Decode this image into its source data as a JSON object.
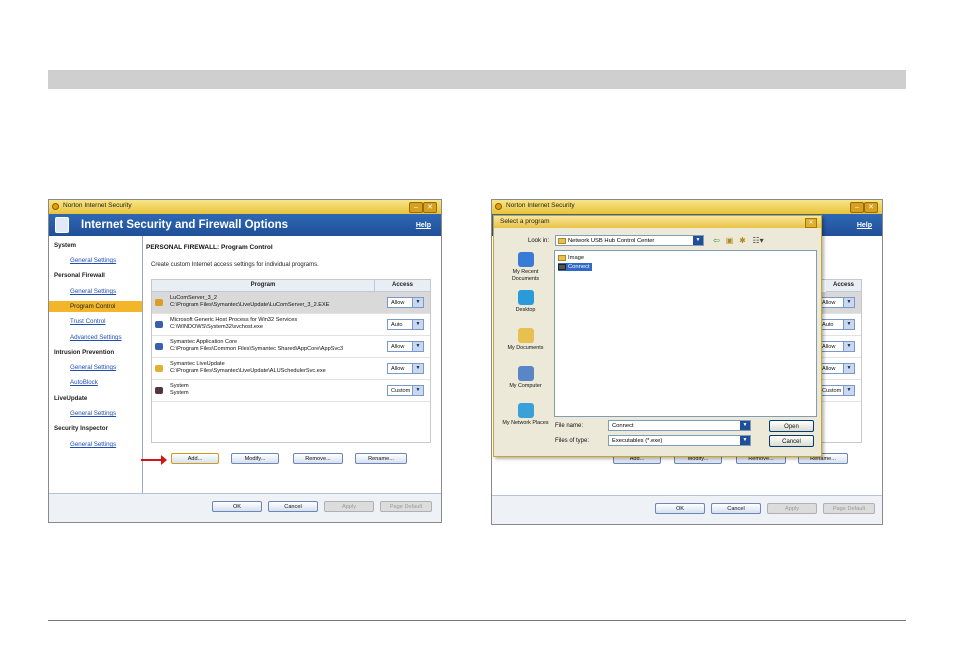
{
  "left_window": {
    "title": "Norton Internet Security",
    "header_title": "Internet Security and Firewall Options",
    "help": "Help",
    "sidebar": [
      {
        "label": "System",
        "kind": "cat"
      },
      {
        "label": "General Settings",
        "kind": "sub"
      },
      {
        "label": "Personal Firewall",
        "kind": "cat"
      },
      {
        "label": "General Settings",
        "kind": "sub"
      },
      {
        "label": "Program Control",
        "kind": "sub",
        "selected": true
      },
      {
        "label": "Trust Control",
        "kind": "sub"
      },
      {
        "label": "Advanced Settings",
        "kind": "sub"
      },
      {
        "label": "Intrusion Prevention",
        "kind": "cat"
      },
      {
        "label": "General Settings",
        "kind": "sub"
      },
      {
        "label": "AutoBlock",
        "kind": "sub"
      },
      {
        "label": "LiveUpdate",
        "kind": "cat"
      },
      {
        "label": "General Settings",
        "kind": "sub"
      },
      {
        "label": "Security Inspector",
        "kind": "cat"
      },
      {
        "label": "General Settings",
        "kind": "sub"
      }
    ],
    "content_heading": "PERSONAL FIREWALL: Program Control",
    "content_desc": "Create custom Internet access settings for individual programs.",
    "columns": {
      "program": "Program",
      "access": "Access"
    },
    "rows": [
      {
        "name": "LuComServer_3_2",
        "path": "C:\\Program Files\\Symantec\\LiveUpdate\\LuComServer_3_2.EXE",
        "access": "Allow",
        "icon_color": "#d8a020"
      },
      {
        "name": "Microsoft Generic Host Process for Win32 Services",
        "path": "C:\\WINDOWS\\System32\\svchost.exe",
        "access": "Auto",
        "icon_color": "#3a5fae"
      },
      {
        "name": "Symantec Application Core",
        "path": "C:\\Program Files\\Common Files\\Symantec Shared\\AppCore\\AppSvc3",
        "access": "Allow",
        "icon_color": "#3a5fae"
      },
      {
        "name": "Symantec LiveUpdate",
        "path": "C:\\Program Files\\Symantec\\LiveUpdate\\ALUSchedulerSvc.exe",
        "access": "Allow",
        "icon_color": "#e0b030"
      },
      {
        "name": "System",
        "path": "System",
        "access": "Custom",
        "icon_color": "#553344"
      }
    ],
    "buttons": {
      "add": "Add...",
      "modify": "Modify...",
      "remove": "Remove...",
      "rename": "Rename..."
    },
    "footer": {
      "ok": "OK",
      "cancel": "Cancel",
      "apply": "Apply",
      "page_default": "Page Default"
    }
  },
  "right_window": {
    "title": "Norton Internet Security",
    "help": "Help",
    "access_header": "Access",
    "access_values": [
      "Allow",
      "Auto",
      "Allow",
      "Allow",
      "Custom"
    ],
    "buttons": {
      "add": "Add...",
      "modify": "Modify...",
      "remove": "Remove...",
      "rename": "Rename..."
    },
    "footer": {
      "ok": "OK",
      "cancel": "Cancel",
      "apply": "Apply",
      "page_default": "Page Default"
    },
    "dialog": {
      "title": "Select a program",
      "look_in_label": "Look in:",
      "look_in_value": "Network USB Hub Control Center",
      "places": [
        "My Recent Documents",
        "Desktop",
        "My Documents",
        "My Computer",
        "My Network Places"
      ],
      "files": [
        {
          "name": "Image",
          "selected": false
        },
        {
          "name": "Connect",
          "selected": true
        }
      ],
      "file_name_label": "File name:",
      "file_name_value": "Connect",
      "files_of_type_label": "Files of type:",
      "files_of_type_value": "Executables (*.exe)",
      "open": "Open",
      "cancel": "Cancel"
    }
  }
}
